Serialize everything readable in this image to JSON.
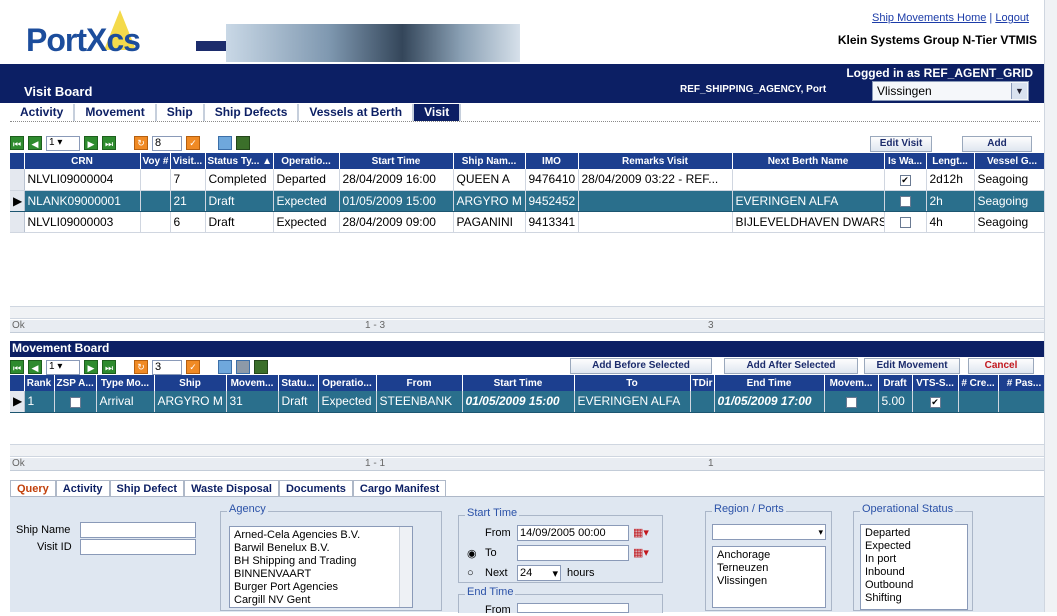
{
  "header": {
    "logo_text": "PortXcs",
    "links": {
      "home": "Ship Movements Home",
      "logout": "Logout"
    },
    "company": "Klein Systems Group N-Tier VTMIS"
  },
  "nav": {
    "title": "Visit Board",
    "logged_in": "Logged in as REF_AGENT_GRID",
    "agency_port_label": "REF_SHIPPING_AGENCY, Port",
    "port_value": "Vlissingen"
  },
  "tabs": [
    "Activity",
    "Movement",
    "Ship",
    "Ship Defects",
    "Vessels at Berth",
    "Visit"
  ],
  "active_tab": "Visit",
  "visit_grid": {
    "page": "1",
    "page_size": "8",
    "buttons": {
      "edit": "Edit Visit",
      "add": "Add"
    },
    "columns": [
      "CRN",
      "Voy #",
      "Visit...",
      "Status Ty... ▲",
      "Operatio...",
      "Start Time",
      "Ship Nam...",
      "IMO",
      "Remarks Visit",
      "Next Berth Name",
      "Is Wa...",
      "Lengt...",
      "Vessel G..."
    ],
    "rows": [
      {
        "crn": "NLVLI09000004",
        "voy": "",
        "visit": "7",
        "status": "Completed",
        "op": "Departed",
        "start": "28/04/2009 16:00",
        "ship": "QUEEN A",
        "imo": "9476410",
        "remarks": "28/04/2009 03:22 - REF...",
        "berth": "",
        "waiting": true,
        "length": "2d12h",
        "group": "Seagoing",
        "selected": false
      },
      {
        "crn": "NLANK09000001",
        "voy": "",
        "visit": "21",
        "status": "Draft",
        "op": "Expected",
        "start": "01/05/2009 15:00",
        "ship": "ARGYRO M",
        "imo": "9452452",
        "remarks": "",
        "berth": "EVERINGEN ALFA",
        "waiting": false,
        "length": "2h",
        "group": "Seagoing",
        "selected": true
      },
      {
        "crn": "NLVLI09000003",
        "voy": "",
        "visit": "6",
        "status": "Draft",
        "op": "Expected",
        "start": "28/04/2009 09:00",
        "ship": "PAGANINI",
        "imo": "9413341",
        "remarks": "",
        "berth": "BIJLEVELDHAVEN DWARS",
        "waiting": false,
        "length": "4h",
        "group": "Seagoing",
        "selected": false
      }
    ],
    "status_ok": "Ok",
    "status_range": "1 - 3",
    "status_total": "3"
  },
  "movement_board": {
    "title": "Movement Board",
    "page": "1",
    "page_size": "3",
    "buttons": {
      "before": "Add Before Selected",
      "after": "Add After Selected",
      "edit": "Edit Movement",
      "cancel": "Cancel"
    },
    "columns": [
      "Rank",
      "ZSP A...",
      "Type Mo...",
      "Ship",
      "Movem...",
      "Statu...",
      "Operatio...",
      "From",
      "Start Time",
      "To",
      "TDir",
      "End Time",
      "Movem...",
      "Draft",
      "VTS-S...",
      "# Cre...",
      "# Pas..."
    ],
    "rows": [
      {
        "rank": "1",
        "zsp": false,
        "type": "Arrival",
        "ship": "ARGYRO M",
        "mov": "31",
        "status": "Draft",
        "op": "Expected",
        "from": "STEENBANK",
        "start": "01/05/2009 15:00",
        "to": "EVERINGEN ALFA",
        "tdir": "",
        "end": "01/05/2009 17:00",
        "movem": false,
        "draft": "5.00",
        "vts": true,
        "crew": "",
        "pas": ""
      }
    ],
    "status_ok": "Ok",
    "status_range": "1 - 1",
    "status_total": "1"
  },
  "query_tabs": [
    "Query",
    "Activity",
    "Ship Defect",
    "Waste Disposal",
    "Documents",
    "Cargo Manifest"
  ],
  "query": {
    "ship_name_label": "Ship Name",
    "visit_id_label": "Visit ID",
    "agency_label": "Agency",
    "agencies": [
      "Arned-Cela Agencies B.V.",
      "Barwil Benelux B.V.",
      "BH Shipping and Trading",
      "BINNENVAART",
      "Burger Port Agencies",
      "Cargill NV Gent"
    ],
    "start_time_label": "Start Time",
    "from_label": "From",
    "from_value": "14/09/2005 00:00",
    "to_label": "To",
    "next_label": "Next",
    "next_value": "24",
    "hours_label": "hours",
    "end_time_label": "End Time",
    "end_from_label": "From",
    "region_label": "Region / Ports",
    "regions": [
      "Anchorage",
      "Terneuzen",
      "Vlissingen"
    ],
    "op_status_label": "Operational Status",
    "op_statuses": [
      "Departed",
      "Expected",
      "In port",
      "Inbound",
      "Outbound",
      "Shifting"
    ]
  }
}
